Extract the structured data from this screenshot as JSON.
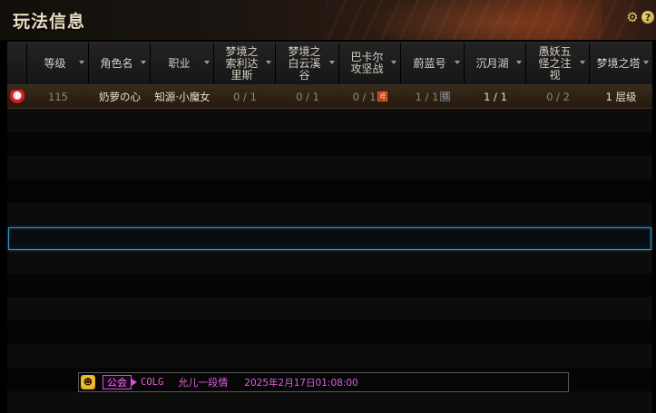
{
  "window": {
    "title": "玩法信息"
  },
  "top_icons": [
    {
      "name": "settings",
      "glyph": "⚙"
    },
    {
      "name": "help",
      "glyph": "?"
    }
  ],
  "table": {
    "columns": [
      {
        "label": "",
        "sortable": false
      },
      {
        "label": "等级",
        "sortable": true
      },
      {
        "label": "角色名",
        "sortable": true
      },
      {
        "label": "职业",
        "sortable": true
      },
      {
        "label": "梦境之索利达里斯",
        "sortable": true
      },
      {
        "label": "梦境之白云溪谷",
        "sortable": true
      },
      {
        "label": "巴卡尔攻坚战",
        "sortable": true
      },
      {
        "label": "蔚蓝号",
        "sortable": true
      },
      {
        "label": "沉月湖",
        "sortable": true
      },
      {
        "label": "愚妖五怪之注视",
        "sortable": true
      },
      {
        "label": "梦境之塔",
        "sortable": true
      }
    ],
    "rows": [
      {
        "level": "115",
        "name": "奶萝の心",
        "class": "知源·小魔女",
        "solidaris": "0 / 1",
        "baiyun": "0 / 1",
        "bakal": "0 / 1",
        "bakal_badge": "难",
        "azure": "1 / 1",
        "azure_badge": "锁",
        "moonlake": "1 / 1",
        "fivemonsters": "0 / 2",
        "tower": "1 层级"
      }
    ]
  },
  "guild": {
    "tag": "公会",
    "name": "COLG",
    "player": "允儿一段情",
    "date": "2025年2月17日01:08:00"
  },
  "colors": {
    "selection": "#3a8ec4",
    "guild_text": "#e060e0",
    "row_highlight": "#3a2a1a"
  }
}
